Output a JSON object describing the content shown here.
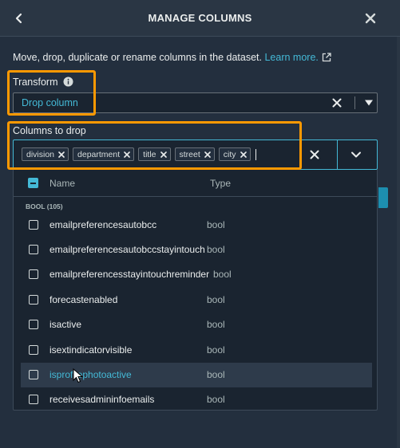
{
  "header": {
    "title": "MANAGE COLUMNS",
    "back_icon": "chevron-left-icon",
    "close_icon": "close-icon"
  },
  "description": {
    "text": "Move, drop, duplicate or rename columns in the dataset.",
    "link": "Learn more.",
    "link_icon": "external-link-icon"
  },
  "transform": {
    "label": "Transform",
    "info_icon": "info-icon",
    "value": "Drop column"
  },
  "columns_to_drop": {
    "label": "Columns to drop",
    "tokens": [
      "division",
      "department",
      "title",
      "street",
      "city"
    ]
  },
  "dropdown": {
    "headers": {
      "name": "Name",
      "type": "Type"
    },
    "group_label": "BOOL (105)",
    "rows": [
      {
        "name": "emailpreferencesautobcc",
        "type": "bool"
      },
      {
        "name": "emailpreferencesautobccstayintouch",
        "type": "bool"
      },
      {
        "name": "emailpreferencesstayintouchreminder",
        "type": "bool"
      },
      {
        "name": "forecastenabled",
        "type": "bool"
      },
      {
        "name": "isactive",
        "type": "bool"
      },
      {
        "name": "isextindicatorvisible",
        "type": "bool"
      },
      {
        "name": "isprofilephotoactive",
        "type": "bool"
      },
      {
        "name": "receivesadmininfoemails",
        "type": "bool"
      }
    ]
  },
  "colors": {
    "background": "#232f3e",
    "accent": "#44b9d6",
    "highlight": "#ff9900"
  }
}
